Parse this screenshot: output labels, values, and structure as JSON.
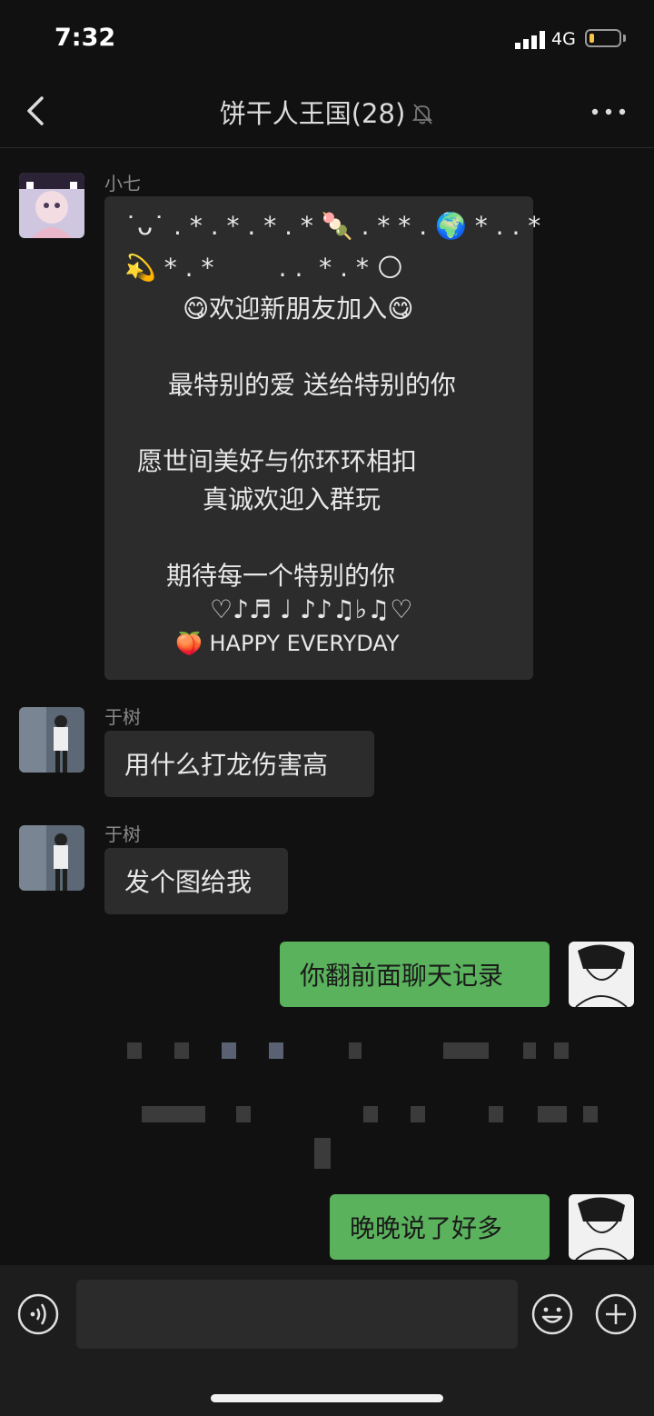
{
  "status": {
    "time": "7:32",
    "network": "4G",
    "battery_level": 0.15
  },
  "nav": {
    "title": "饼干人王国(28)"
  },
  "messages": [
    {
      "sender": "小七",
      "lines": [
        "˙ᴗ˙ . * . * . * . * 🍡 . * * . 🌍 * . . *",
        "💫 * . *        . .  * . * 🌕",
        "😋欢迎新朋友加入😋",
        "最特别的爱 送给特别的你",
        "愿世间美好与你环环相扣",
        "真诚欢迎入群玩",
        "期待每一个特别的你",
        "♡♪♬ ♩ ♪♪♫♭♫♡",
        "🍑 HAPPY EVERYDAY"
      ]
    },
    {
      "sender": "于树",
      "text": "用什么打龙伤害高"
    },
    {
      "sender": "于树",
      "text": "发个图给我"
    },
    {
      "sender": "me",
      "text": "你翻前面聊天记录"
    },
    {
      "sender": "me",
      "text": "晚晚说了好多"
    }
  ],
  "input": {
    "placeholder": ""
  }
}
